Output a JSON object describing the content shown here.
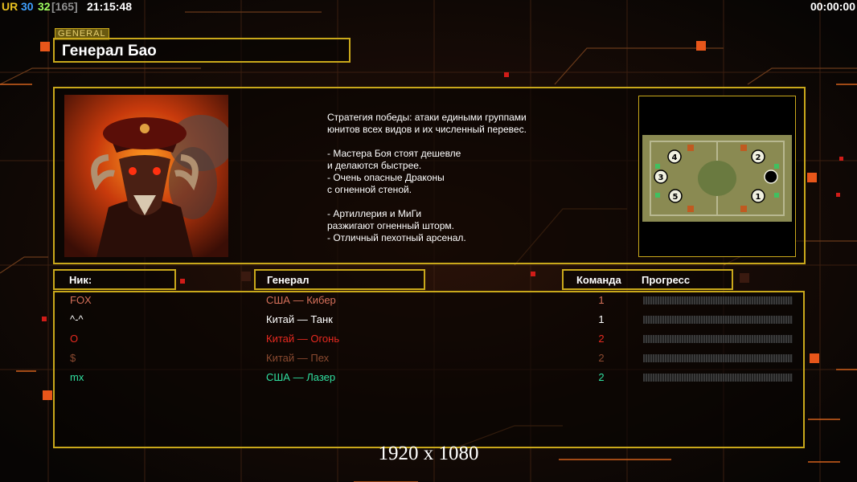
{
  "hud": {
    "label": "UR",
    "value_a": "30",
    "value_b": "32",
    "value_c": "[165]",
    "clock": "21:15:48",
    "timer": "00:00:00",
    "colors": {
      "label": "#e8c020",
      "value_a": "#3fa0ff",
      "value_b": "#a0ff60",
      "value_c": "#909090",
      "clock": "#ffffff"
    }
  },
  "general": {
    "tag": "GENERAL",
    "name": "Генерал Бао",
    "description": [
      "Стратегия победы: атаки едиными группами",
      "юнитов всех видов и их численный перевес.",
      "",
      "- Мастера Боя стоят дешевле",
      "и делаются быстрее.",
      "- Очень опасные Драконы",
      "с огненной стеной.",
      "",
      "- Артиллерия и МиГи",
      "разжигают огненный шторм.",
      "- Отличный пехотный арсенал."
    ],
    "portrait_icon": "demon-general-portrait",
    "map_icon": "skirmish-minimap",
    "map_spawns": [
      "4",
      "2",
      "3",
      "5",
      "1"
    ]
  },
  "table": {
    "headers": {
      "nick": "Ник:",
      "general": "Генерал",
      "team": "Команда",
      "progress": "Прогресс"
    },
    "rows": [
      {
        "nick": "FOX",
        "general": "США — Кибер",
        "team": "1",
        "color": "#d6705a",
        "progress": 0
      },
      {
        "nick": "^-^",
        "general": "Китай — Танк",
        "team": "1",
        "color": "#ffffff",
        "progress": 0
      },
      {
        "nick": "O",
        "general": "Китай — Огонь",
        "team": "2",
        "color": "#e82a20",
        "progress": 0
      },
      {
        "nick": "$",
        "general": "Китай — Пех",
        "team": "2",
        "color": "#8a4a30",
        "progress": 0
      },
      {
        "nick": "mx",
        "general": "США — Лазер",
        "team": "2",
        "color": "#30e0a0",
        "progress": 0
      }
    ]
  },
  "watermark": "1920 x 1080",
  "accent_color": "#c9a81b"
}
